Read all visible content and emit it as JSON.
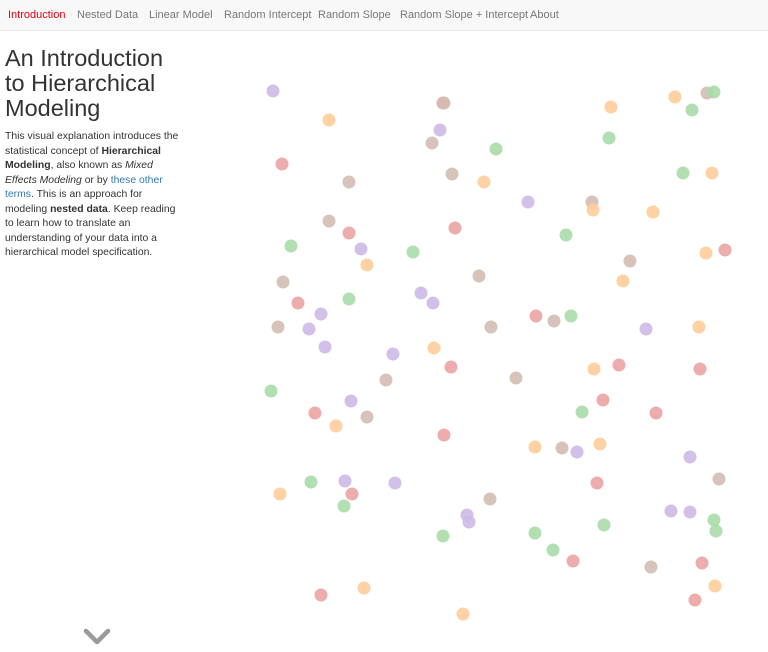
{
  "nav": {
    "items": [
      {
        "label": "Introduction",
        "active": true
      },
      {
        "label": "Nested Data",
        "active": false
      },
      {
        "label": "Linear Model",
        "active": false
      },
      {
        "label": "Random Intercept",
        "active": false
      },
      {
        "label": "Random Slope",
        "active": false
      },
      {
        "label": "Random Slope + Intercept",
        "active": false
      },
      {
        "label": "About",
        "active": false
      }
    ]
  },
  "intro": {
    "title": "An Introduction to Hierarchical Modeling",
    "p1": "This visual explanation introduces the statistical concept of ",
    "term_hierarchical": "Hierarchical Modeling",
    "p2": ", also known as ",
    "term_mixed": "Mixed Effects Modeling",
    "p3": " or by ",
    "link_terms": "these other terms",
    "p4": ". This is an approach for modeling ",
    "term_nested": "nested data",
    "p5": ". Keep reading to learn how to translate an understanding of your data into a hierarchical model specification."
  },
  "scroll_icon": "chevron-down-icon",
  "colors": {
    "purple": "#cdb9e6",
    "orange": "#ffcc99",
    "green": "#a8dba8",
    "red": "#eba4a4",
    "brown": "#d3bcb3",
    "accent": "#e8000b",
    "link": "#337ab7"
  }
}
